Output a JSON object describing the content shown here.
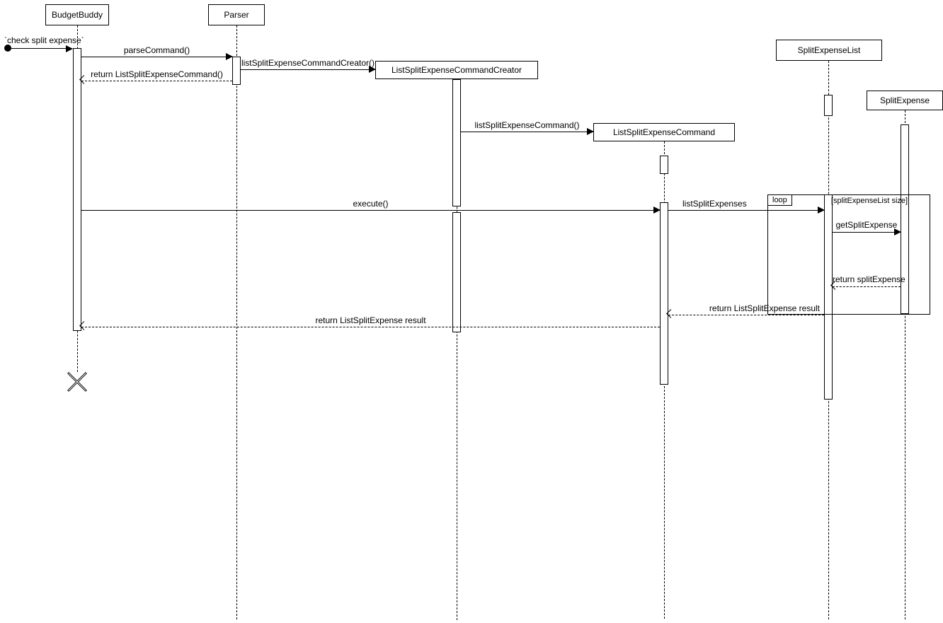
{
  "participants": {
    "budgetBuddy": "BudgetBuddy",
    "parser": "Parser",
    "creator": "ListSplitExpenseCommandCreator",
    "command": "ListSplitExpenseCommand",
    "splitList": "SplitExpenseList",
    "splitExpense": "SplitExpense"
  },
  "startMessage": "`check split expense`",
  "messages": {
    "parseCommand": "parseCommand()",
    "creatorCall": "listSplitExpenseCommandCreator()",
    "returnCommand": "return ListSplitExpenseCommand()",
    "commandCall": "listSplitExpenseCommand()",
    "execute": "execute()",
    "listSplitExpenses": "listSplitExpenses",
    "getSplitExpense": "getSplitExpense",
    "returnSplitExpense": "return splitExpense",
    "returnResult1": "return ListSplitExpense result",
    "returnResult2": "return ListSplitExpense result"
  },
  "loop": {
    "label": "loop",
    "condition": "[splitExpenseList size]"
  }
}
